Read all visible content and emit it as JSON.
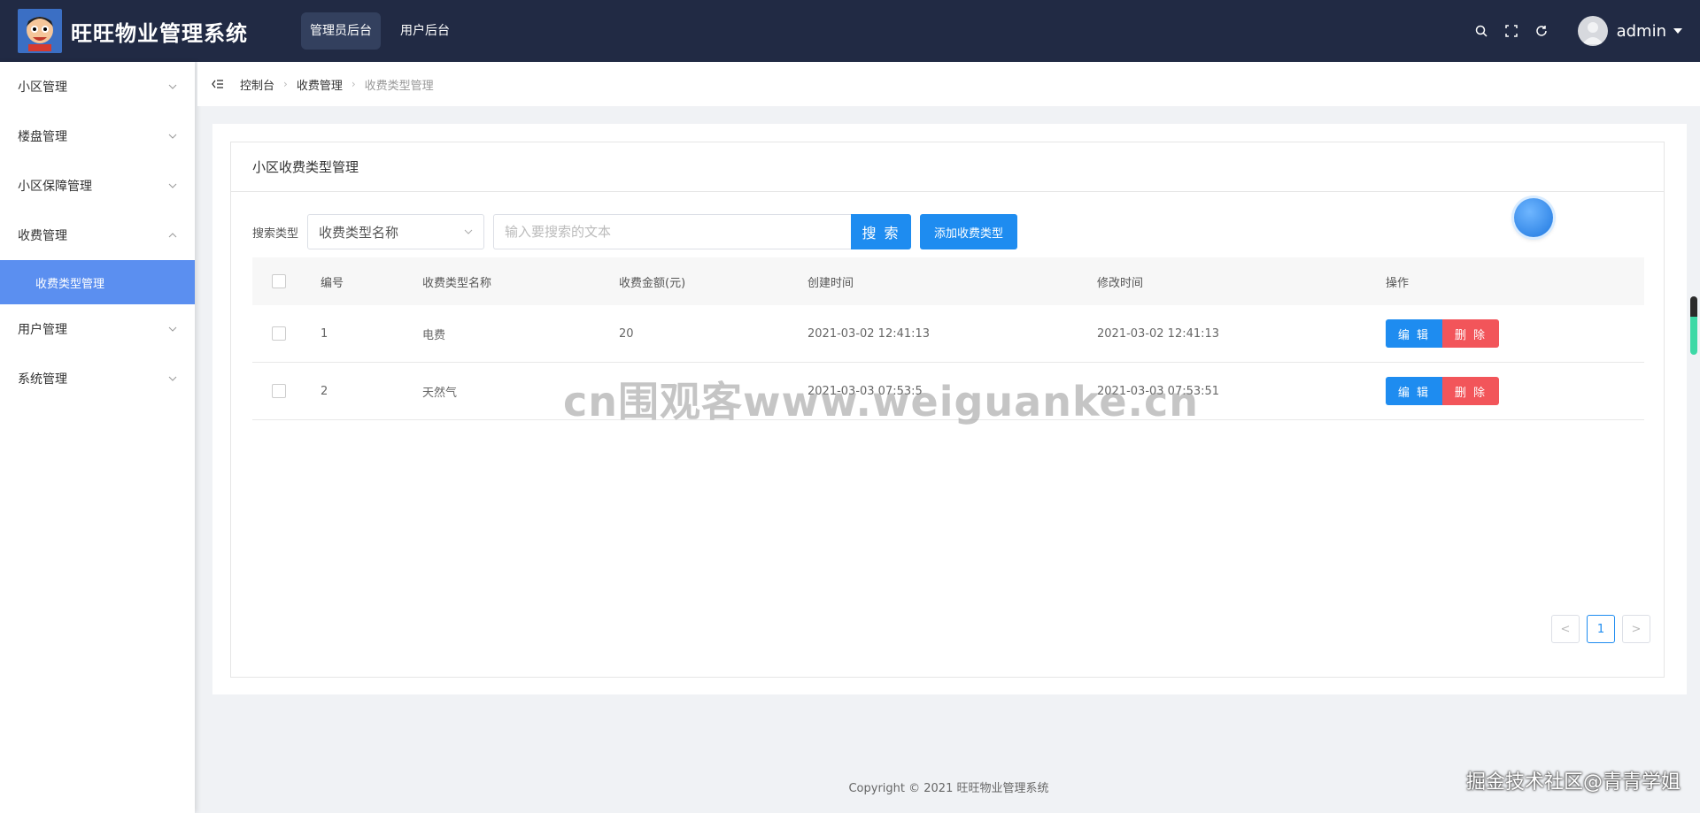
{
  "header": {
    "app_title": "旺旺物业管理系统",
    "tabs": [
      {
        "label": "管理员后台",
        "active": true
      },
      {
        "label": "用户后台",
        "active": false
      }
    ],
    "icons": [
      "search-icon",
      "fullscreen-icon",
      "refresh-icon"
    ],
    "username": "admin"
  },
  "sidebar": {
    "items": [
      {
        "label": "小区管理",
        "expanded": false
      },
      {
        "label": "楼盘管理",
        "expanded": false
      },
      {
        "label": "小区保障管理",
        "expanded": false
      },
      {
        "label": "收费管理",
        "expanded": true,
        "children": [
          {
            "label": "收费类型管理",
            "active": true
          }
        ]
      },
      {
        "label": "用户管理",
        "expanded": false
      },
      {
        "label": "系统管理",
        "expanded": false
      }
    ]
  },
  "breadcrumb": [
    "控制台",
    "收费管理",
    "收费类型管理"
  ],
  "panel": {
    "title": "小区收费类型管理",
    "search_label": "搜索类型",
    "select_value": "收费类型名称",
    "search_placeholder": "输入要搜索的文本",
    "search_button": "搜 索",
    "add_button": "添加收费类型"
  },
  "table": {
    "columns": [
      "编号",
      "收费类型名称",
      "收费金额(元)",
      "创建时间",
      "修改时间",
      "操作"
    ],
    "rows": [
      {
        "id": "1",
        "name": "电费",
        "amount": "20",
        "created": "2021-03-02 12:41:13",
        "modified": "2021-03-02 12:41:13"
      },
      {
        "id": "2",
        "name": "天然气",
        "amount": "",
        "created": "2021-03-03 07:53:5",
        "modified": "2021-03-03 07:53:51"
      }
    ],
    "edit_label": "编 辑",
    "delete_label": "删 除"
  },
  "pagination": {
    "current": "1",
    "prev": "<",
    "next": ">"
  },
  "footer": "Copyright © 2021 旺旺物业管理系统",
  "watermark": "cn围观客www.weiguanke.cn",
  "corner_mark": "掘金技术社区@青青学姐",
  "colors": {
    "header_bg": "#212a44",
    "primary": "#1e8cf0",
    "danger": "#f2555a",
    "sidebar_active": "#5b8ff0"
  }
}
